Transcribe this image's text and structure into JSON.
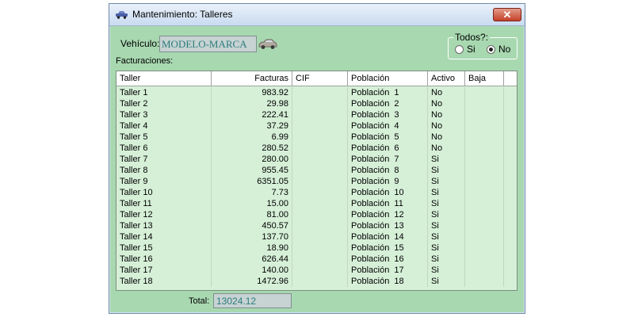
{
  "window": {
    "title": "Mantenimiento: Talleres",
    "close_label": "✕"
  },
  "vehiculo": {
    "label": "Vehículo:",
    "value": "MODELO-MARCA"
  },
  "todos": {
    "legend": "Todos?:",
    "options": [
      "Si",
      "No"
    ],
    "selected": "No"
  },
  "facturaciones_label": "Facturaciones:",
  "table": {
    "columns": [
      "Taller",
      "Facturas",
      "CIF",
      "Población",
      "Activo",
      "Baja"
    ],
    "rows": [
      [
        "Taller 1",
        "983.92",
        "",
        "Población  1",
        "No",
        ""
      ],
      [
        "Taller 2",
        "29.98",
        "",
        "Población  2",
        "No",
        ""
      ],
      [
        "Taller 3",
        "222.41",
        "",
        "Población  3",
        "No",
        ""
      ],
      [
        "Taller 4",
        "37.29",
        "",
        "Población  4",
        "No",
        ""
      ],
      [
        "Taller 5",
        "6.99",
        "",
        "Población  5",
        "No",
        ""
      ],
      [
        "Taller 6",
        "280.52",
        "",
        "Población  6",
        "No",
        ""
      ],
      [
        "Taller 7",
        "280.00",
        "",
        "Población  7",
        "Si",
        ""
      ],
      [
        "Taller 8",
        "955.45",
        "",
        "Población  8",
        "Si",
        ""
      ],
      [
        "Taller 9",
        "6351.05",
        "",
        "Población  9",
        "Si",
        ""
      ],
      [
        "Taller 10",
        "7.73",
        "",
        "Población  10",
        "Si",
        ""
      ],
      [
        "Taller 11",
        "15.00",
        "",
        "Población  11",
        "Si",
        ""
      ],
      [
        "Taller 12",
        "81.00",
        "",
        "Población  12",
        "Si",
        ""
      ],
      [
        "Taller 13",
        "450.57",
        "",
        "Población  13",
        "Si",
        ""
      ],
      [
        "Taller 14",
        "137.70",
        "",
        "Población  14",
        "Si",
        ""
      ],
      [
        "Taller 15",
        "18.90",
        "",
        "Población  15",
        "Si",
        ""
      ],
      [
        "Taller 16",
        "626.44",
        "",
        "Población  16",
        "Si",
        ""
      ],
      [
        "Taller 17",
        "140.00",
        "",
        "Población  17",
        "Si",
        ""
      ],
      [
        "Taller 18",
        "1472.96",
        "",
        "Población  18",
        "Si",
        ""
      ]
    ]
  },
  "total": {
    "label": "Total:",
    "value": "13024.12"
  },
  "icons": {
    "app": "car-icon",
    "vehicle_button": "car-icon",
    "close": "close-icon"
  },
  "colors": {
    "form_bg": "#a8d8b0",
    "grid_bg": "#d6f0d8",
    "field_text": "#2c7b7b",
    "close_red": "#c4412a"
  }
}
